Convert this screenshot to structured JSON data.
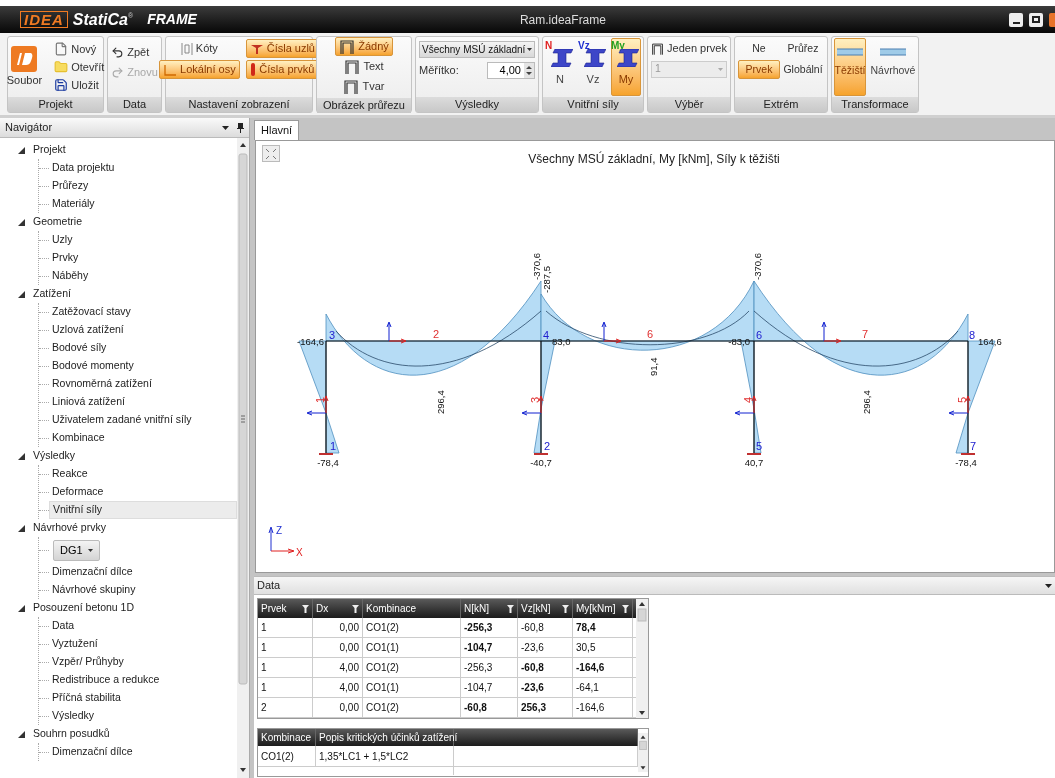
{
  "window": {
    "logo": "IDEA",
    "product": "StatiCa",
    "registered": "®",
    "edition": "FRAME",
    "title": "Ram.ideaFrame"
  },
  "ribbon": [
    {
      "label": "Projekt",
      "items": [
        {
          "label": "Soubor"
        },
        {
          "label": "Nový"
        },
        {
          "label": "Otevřít"
        },
        {
          "label": "Uložit"
        }
      ]
    },
    {
      "label": "Data",
      "items": [
        {
          "label": "Zpět",
          "disabled": false
        },
        {
          "label": "Znovu",
          "disabled": true
        }
      ]
    },
    {
      "label": "Nastavení zobrazení",
      "items": [
        {
          "label": "Kóty",
          "selected": false
        },
        {
          "label": "Čísla uzlů",
          "selected": true
        },
        {
          "label": "Lokální osy",
          "selected": true
        },
        {
          "label": "Čísla prvků",
          "selected": true
        }
      ]
    },
    {
      "label": "Obrázek průřezu",
      "items": [
        {
          "label": "Žádný",
          "selected": true
        },
        {
          "label": "Text",
          "selected": false
        },
        {
          "label": "Tvar",
          "selected": false
        }
      ]
    },
    {
      "label": "Výsledky",
      "items": [
        {
          "value": "Všechny MSÚ základní"
        },
        {
          "label": "Měřítko:",
          "value": "4,00"
        }
      ]
    },
    {
      "label": "Vnitřní síly",
      "items": [
        {
          "label": "N",
          "badge": "N",
          "color": "#e02020",
          "selected": false
        },
        {
          "label": "Vz",
          "badge": "Vz",
          "color": "#2030d0",
          "selected": false
        },
        {
          "label": "My",
          "badge": "My",
          "color": "#20a020",
          "selected": true
        }
      ]
    },
    {
      "label": "Výběr",
      "items": [
        {
          "label": "Jeden prvek"
        },
        {
          "value": "1",
          "disabled": true
        }
      ]
    },
    {
      "label": "Extrém",
      "items": [
        {
          "label": "Ne",
          "selected": false
        },
        {
          "label": "Průřez",
          "selected": false
        },
        {
          "label": "Prvek",
          "selected": true
        },
        {
          "label": "Globální",
          "selected": false
        }
      ]
    },
    {
      "label": "Transformace",
      "items": [
        {
          "label": "Těžiští",
          "selected": true
        },
        {
          "label": "Návrhové",
          "selected": false
        }
      ]
    }
  ],
  "navigator": {
    "title": "Navigátor",
    "tree": [
      {
        "label": "Projekt",
        "expanded": true,
        "children": [
          {
            "label": "Data projektu",
            "selected": false
          },
          {
            "label": "Průřezy",
            "selected": false
          },
          {
            "label": "Materiály",
            "selected": false
          }
        ]
      },
      {
        "label": "Geometrie",
        "expanded": true,
        "children": [
          {
            "label": "Uzly",
            "selected": false
          },
          {
            "label": "Prvky",
            "selected": false
          },
          {
            "label": "Náběhy",
            "selected": false
          }
        ]
      },
      {
        "label": "Zatížení",
        "expanded": true,
        "children": [
          {
            "label": "Zatěžovací stavy",
            "selected": false
          },
          {
            "label": "Uzlová zatížení",
            "selected": false
          },
          {
            "label": "Bodové síly",
            "selected": false
          },
          {
            "label": "Bodové momenty",
            "selected": false
          },
          {
            "label": "Rovnoměrná zatížení",
            "selected": false
          },
          {
            "label": "Liniová zatížení",
            "selected": false
          },
          {
            "label": "Uživatelem zadané vnitřní síly",
            "selected": false
          },
          {
            "label": "Kombinace",
            "selected": false
          }
        ]
      },
      {
        "label": "Výsledky",
        "expanded": true,
        "children": [
          {
            "label": "Reakce",
            "selected": false
          },
          {
            "label": "Deformace",
            "selected": false
          },
          {
            "label": "Vnitřní síly",
            "selected": true
          }
        ]
      },
      {
        "label": "Návrhové prvky",
        "expanded": true,
        "children": [
          {
            "kind": "dropdown",
            "label": "DG1",
            "selected": false
          },
          {
            "kind": "item",
            "label": "Dimenzační dílce",
            "selected": false
          },
          {
            "kind": "item",
            "label": "Návrhové skupiny",
            "selected": false
          }
        ]
      },
      {
        "label": "Posouzení betonu 1D",
        "expanded": true,
        "children": [
          {
            "label": "Data",
            "selected": false
          },
          {
            "label": "Vyztužení",
            "selected": false
          },
          {
            "label": "Vzpěr/ Průhyby",
            "selected": false
          },
          {
            "label": "Redistribuce a redukce",
            "selected": false
          },
          {
            "label": "Příčná stabilita",
            "selected": false
          },
          {
            "label": "Výsledky",
            "selected": false
          }
        ]
      },
      {
        "label": "Souhrn posudků",
        "expanded": true,
        "children": [
          {
            "label": "Dimenzační dílce",
            "selected": false
          }
        ]
      }
    ]
  },
  "tabs": [
    {
      "label": "Hlavní",
      "selected": true
    }
  ],
  "diagram": {
    "title": "Všechny MSÚ základní, My [kNm], Síly k těžišti",
    "beam_values": [
      "-164,6",
      "-370,6",
      "-287,5",
      "83,0",
      "91,4",
      "-370,6",
      "-83,0",
      "164,6"
    ],
    "span_values": [
      "296,4",
      "296,4"
    ],
    "base_values": [
      "-78,4",
      "-40,7",
      "40,7",
      "-78,4"
    ],
    "beam_members": [
      "2",
      "6",
      "7"
    ],
    "column_members": [
      "1",
      "3",
      "4",
      "5"
    ],
    "top_nodes": [
      "3",
      "4",
      "6",
      "8"
    ],
    "bottom_nodes": [
      "1",
      "2",
      "5",
      "7"
    ],
    "axes": {
      "z": "Z",
      "x": "X"
    }
  },
  "data_panel": {
    "title": "Data",
    "table": {
      "columns": [
        {
          "label": "Prvek",
          "filter": true
        },
        {
          "label": "Dx",
          "filter": true
        },
        {
          "label": "Kombinace",
          "filter": false
        },
        {
          "label": "N[kN]",
          "filter": true
        },
        {
          "label": "Vz[kN]",
          "filter": true
        },
        {
          "label": "My[kNm]",
          "filter": true
        }
      ],
      "rows": [
        [
          {
            "text": "1",
            "bold": false
          },
          {
            "text": "0,00",
            "bold": false
          },
          {
            "text": "CO1(2)",
            "bold": false
          },
          {
            "text": "-256,3",
            "bold": true
          },
          {
            "text": "-60,8",
            "bold": false
          },
          {
            "text": "78,4",
            "bold": true
          }
        ],
        [
          {
            "text": "1",
            "bold": false
          },
          {
            "text": "0,00",
            "bold": false
          },
          {
            "text": "CO1(1)",
            "bold": false
          },
          {
            "text": "-104,7",
            "bold": true
          },
          {
            "text": "-23,6",
            "bold": false
          },
          {
            "text": "30,5",
            "bold": false
          }
        ],
        [
          {
            "text": "1",
            "bold": false
          },
          {
            "text": "4,00",
            "bold": false
          },
          {
            "text": "CO1(2)",
            "bold": false
          },
          {
            "text": "-256,3",
            "bold": false
          },
          {
            "text": "-60,8",
            "bold": true
          },
          {
            "text": "-164,6",
            "bold": true
          }
        ],
        [
          {
            "text": "1",
            "bold": false
          },
          {
            "text": "4,00",
            "bold": false
          },
          {
            "text": "CO1(1)",
            "bold": false
          },
          {
            "text": "-104,7",
            "bold": false
          },
          {
            "text": "-23,6",
            "bold": true
          },
          {
            "text": "-64,1",
            "bold": false
          }
        ],
        [
          {
            "text": "2",
            "bold": false
          },
          {
            "text": "0,00",
            "bold": false
          },
          {
            "text": "CO1(2)",
            "bold": false
          },
          {
            "text": "-60,8",
            "bold": true
          },
          {
            "text": "256,3",
            "bold": true
          },
          {
            "text": "-164,6",
            "bold": false
          }
        ]
      ]
    },
    "combinations": {
      "columns": [
        "Kombinace",
        "Popis kritických účinků zatížení"
      ],
      "rows": [
        [
          "CO1(2)",
          "1,35*LC1 + 1,5*LC2"
        ]
      ]
    }
  }
}
